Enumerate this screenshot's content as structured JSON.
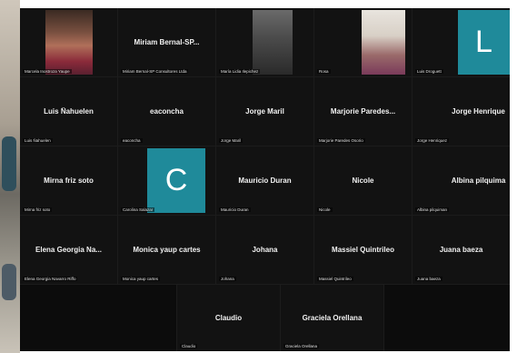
{
  "meeting": {
    "accent_color": "#2d8cff",
    "avatar_color": "#1f8a9a",
    "tiles": [
      {
        "name": "Marcela Inostroza Yaupe",
        "display": "",
        "kind": "video"
      },
      {
        "name": "Miriam Bernal-SP Consultores Ltda",
        "display": "Miriam Bernal-SP...",
        "kind": "name"
      },
      {
        "name": "María Lidia Ilepichez",
        "display": "",
        "kind": "video"
      },
      {
        "name": "Rosa",
        "display": "",
        "kind": "video"
      },
      {
        "name": "Luis Droguett",
        "display": "L",
        "kind": "avatar"
      },
      {
        "name": "Luis Ñahuelen",
        "display": "Luis Ñahuelen",
        "kind": "name"
      },
      {
        "name": "eaconcha",
        "display": "eaconcha",
        "kind": "name"
      },
      {
        "name": "Jorge Maril",
        "display": "Jorge Maril",
        "kind": "name"
      },
      {
        "name": "Marjorie Paredes Osorio",
        "display": "Marjorie Paredes...",
        "kind": "name"
      },
      {
        "name": "Jorge Henriquez",
        "display": "Jorge Henrique",
        "kind": "name"
      },
      {
        "name": "Mirna friz soto",
        "display": "Mirna friz soto",
        "kind": "name"
      },
      {
        "name": "Carolina Salazar",
        "display": "C",
        "kind": "avatar"
      },
      {
        "name": "Mauricio Duran",
        "display": "Mauricio Duran",
        "kind": "name"
      },
      {
        "name": "Nicole",
        "display": "Nicole",
        "kind": "name"
      },
      {
        "name": "Albina pilquiman",
        "display": "Albina pilquima",
        "kind": "name"
      },
      {
        "name": "Elena Georgia Navarro Riffo",
        "display": "Elena Georgia Na...",
        "kind": "name"
      },
      {
        "name": "Monica yaup cartes",
        "display": "Monica yaup cartes",
        "kind": "name"
      },
      {
        "name": "Johana",
        "display": "Johana",
        "kind": "name"
      },
      {
        "name": "Massiel Quintrileo",
        "display": "Massiel Quintrileo",
        "kind": "name"
      },
      {
        "name": "Juana baeza",
        "display": "Juana baeza",
        "kind": "name"
      },
      {
        "name": "Claudio",
        "display": "Claudio",
        "kind": "name"
      },
      {
        "name": "Graciela Orellana",
        "display": "Graciela Orellana",
        "kind": "name"
      }
    ]
  }
}
